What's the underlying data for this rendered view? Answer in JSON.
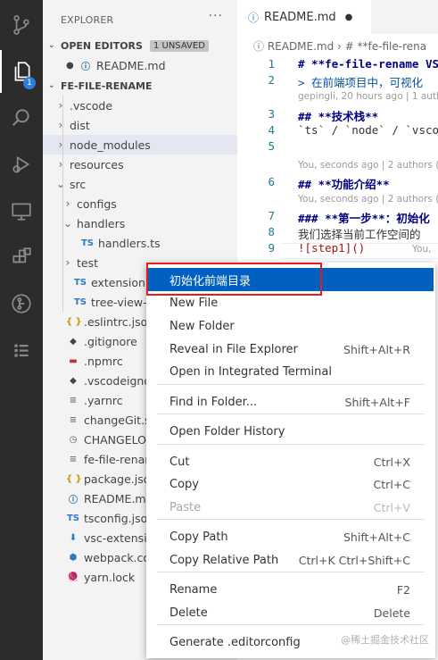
{
  "sidebar": {
    "title": "EXPLORER",
    "more": "···",
    "open_editors": {
      "label": "OPEN EDITORS",
      "badge": "1 UNSAVED",
      "file": "README.md"
    },
    "project": "FE-FILE-RENAME",
    "tree": [
      {
        "label": ".vscode",
        "chev": "›",
        "icon": ""
      },
      {
        "label": "dist",
        "chev": "›",
        "icon": ""
      },
      {
        "label": "node_modules",
        "chev": "›",
        "icon": ""
      },
      {
        "label": "resources",
        "chev": "›",
        "icon": ""
      },
      {
        "label": "src",
        "chev": "⌄",
        "icon": ""
      },
      {
        "label": "configs",
        "chev": "›",
        "icon": ""
      },
      {
        "label": "handlers",
        "chev": "⌄",
        "icon": ""
      },
      {
        "label": "handlers.ts",
        "chev": "",
        "icon": "TS"
      },
      {
        "label": "test",
        "chev": "›",
        "icon": ""
      },
      {
        "label": "extension.ts",
        "chev": "",
        "icon": "TS"
      },
      {
        "label": "tree-view-pro",
        "chev": "",
        "icon": "TS"
      },
      {
        "label": ".eslintrc.json",
        "chev": "",
        "icon": "{ }"
      },
      {
        "label": ".gitignore",
        "chev": "",
        "icon": "◆"
      },
      {
        "label": ".npmrc",
        "chev": "",
        "icon": "▬"
      },
      {
        "label": ".vscodeignore",
        "chev": "",
        "icon": "◆"
      },
      {
        "label": ".yarnrc",
        "chev": "",
        "icon": "≡"
      },
      {
        "label": "changeGit.she",
        "chev": "",
        "icon": "≡"
      },
      {
        "label": "CHANGELOG.m",
        "chev": "",
        "icon": "◷"
      },
      {
        "label": "fe-file-rename",
        "chev": "",
        "icon": "≡"
      },
      {
        "label": "package.json",
        "chev": "",
        "icon": "{ }"
      },
      {
        "label": "README.md",
        "chev": "",
        "icon": "ⓘ"
      },
      {
        "label": "tsconfig.json",
        "chev": "",
        "icon": "TS"
      },
      {
        "label": "vsc-extension-",
        "chev": "",
        "icon": "⬇"
      },
      {
        "label": "webpack.confi",
        "chev": "",
        "icon": "⬢"
      },
      {
        "label": "yarn.lock",
        "chev": "",
        "icon": "🧶"
      }
    ]
  },
  "editor": {
    "tab": "README.md",
    "tab_dirty": "●",
    "breadcrumb": "ⓘ README.md  ›  # **fe-file-rena",
    "lines": [
      {
        "n": "1",
        "text": "# **fe-file-rename VS"
      },
      {
        "n": "2",
        "text": "> 在前端项目中，可视化"
      },
      {
        "n": "3",
        "text": "## **技术栈**"
      },
      {
        "n": "4",
        "text": "`ts` / `node` / `vsco"
      },
      {
        "n": "5",
        "text": ""
      },
      {
        "n": "6",
        "text": "## **功能介绍**"
      },
      {
        "n": "7",
        "text": "### **第一步**：初始化"
      },
      {
        "n": "8",
        "text": "我们选择当前工作空间的"
      },
      {
        "n": "9",
        "text": "![step1]()"
      }
    ],
    "blame": [
      "gepingli, 20 hours ago | 1 auth",
      "You, seconds ago | 2 authors (",
      "You, seconds ago | 2 authors (",
      "You,"
    ]
  },
  "context_menu": {
    "items": [
      {
        "label": "初始化前端目录",
        "shortcut": ""
      },
      {
        "label": "New File",
        "shortcut": ""
      },
      {
        "label": "New Folder",
        "shortcut": ""
      },
      {
        "label": "Reveal in File Explorer",
        "shortcut": "Shift+Alt+R"
      },
      {
        "label": "Open in Integrated Terminal",
        "shortcut": ""
      },
      {
        "label": "Find in Folder...",
        "shortcut": "Shift+Alt+F"
      },
      {
        "label": "Open Folder History",
        "shortcut": ""
      },
      {
        "label": "Cut",
        "shortcut": "Ctrl+X"
      },
      {
        "label": "Copy",
        "shortcut": "Ctrl+C"
      },
      {
        "label": "Paste",
        "shortcut": "Ctrl+V"
      },
      {
        "label": "Copy Path",
        "shortcut": "Shift+Alt+C"
      },
      {
        "label": "Copy Relative Path",
        "shortcut": "Ctrl+K Ctrl+Shift+C"
      },
      {
        "label": "Rename",
        "shortcut": "F2"
      },
      {
        "label": "Delete",
        "shortcut": "Delete"
      },
      {
        "label": "Generate .editorconfig",
        "shortcut": ""
      }
    ]
  },
  "activity": {
    "badge": "1"
  },
  "watermark": "@稀土掘金技术社区"
}
